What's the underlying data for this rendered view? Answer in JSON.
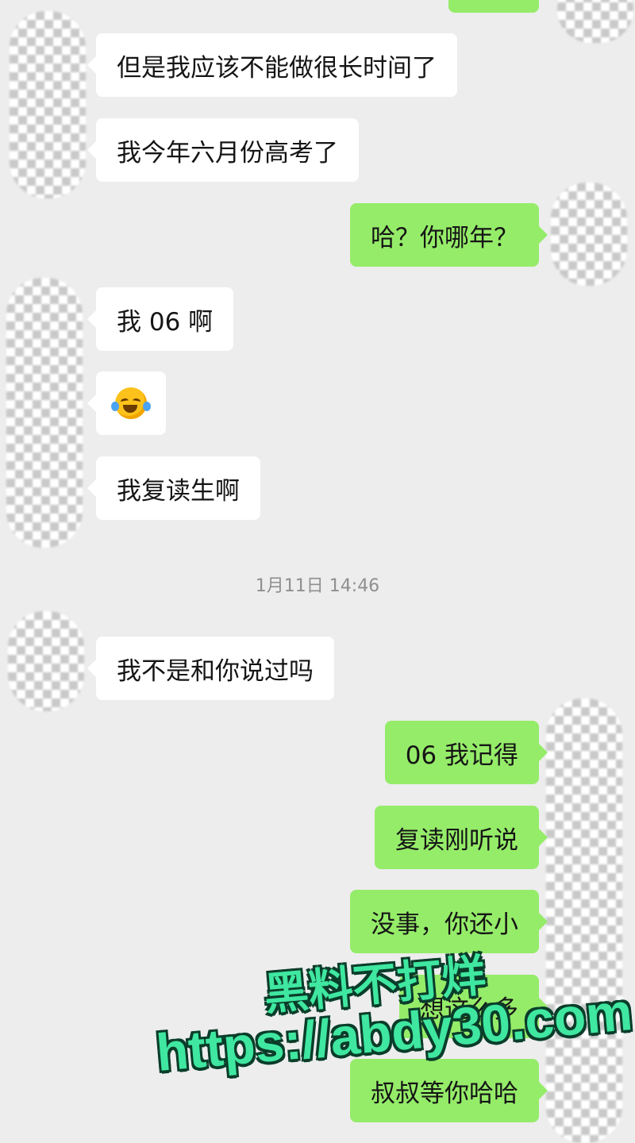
{
  "timestamp": "1月11日 14:46",
  "messages": [
    {
      "side": "out",
      "text": ""
    },
    {
      "side": "in",
      "text": "但是我应该不能做很长时间了"
    },
    {
      "side": "in",
      "text": "我今年六月份高考了"
    },
    {
      "side": "out",
      "text": "哈？你哪年？"
    },
    {
      "side": "in",
      "text": "我 06 啊"
    },
    {
      "side": "in",
      "icon": "face-with-tears-of-joy-emoji"
    },
    {
      "side": "in",
      "text": "我复读生啊"
    },
    {
      "side": "in",
      "text": "我不是和你说过吗"
    },
    {
      "side": "out",
      "text": "06 我记得"
    },
    {
      "side": "out",
      "text": "复读刚听说"
    },
    {
      "side": "out",
      "text": "没事，你还小"
    },
    {
      "side": "out",
      "text": "想这么多"
    },
    {
      "side": "out",
      "text": "叔叔等你哈哈"
    }
  ],
  "watermark": {
    "line1": "黑料不打烊",
    "line2": "https://abdy30.com"
  },
  "colors": {
    "background": "#ededed",
    "incoming_bubble": "#ffffff",
    "outgoing_bubble": "#95ec69",
    "watermark": "#3fe7a0"
  }
}
